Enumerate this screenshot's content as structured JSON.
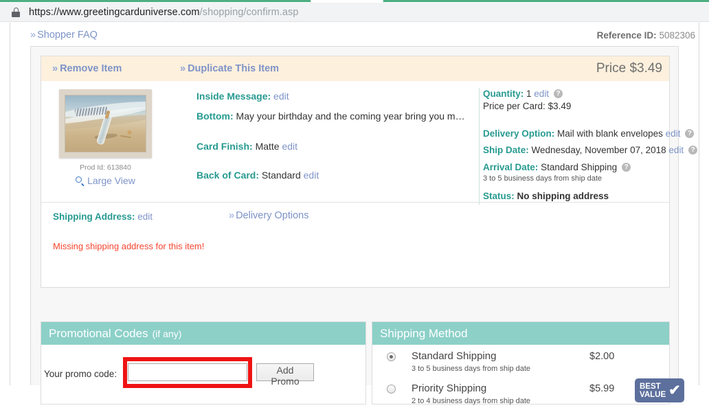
{
  "browser": {
    "url_secure_prefix": "https://www.greetingcarduniverse.com",
    "url_path": "/shopping/confirm.asp",
    "lock_icon": "lock-icon"
  },
  "page": {
    "shopper_faq": "Shopper FAQ",
    "guillemet": "»",
    "reference_label": "Reference ID:",
    "reference_value": "5082306"
  },
  "item": {
    "remove_label": "Remove Item",
    "duplicate_label": "Duplicate This Item",
    "price_label": "Price $3.49",
    "thumbnail": {
      "prod_id": "Prod Id: 613840",
      "large_view": "Large View",
      "magnifier_icon": "magnifier-icon"
    },
    "details": {
      "inside_message_label": "Inside Message:",
      "inside_message_edit": "edit",
      "bottom_label": "Bottom:",
      "bottom_value": "May your birthday and the coming year bring you m…",
      "card_finish_label": "Card Finish:",
      "card_finish_value": "Matte",
      "card_finish_edit": "edit",
      "back_of_card_label": "Back of Card:",
      "back_of_card_value": "Standard",
      "back_of_card_edit": "edit"
    },
    "order": {
      "quantity_label": "Quantity:",
      "quantity_value": "1",
      "quantity_edit": "edit",
      "price_per_card_label": "Price per Card:",
      "price_per_card_value": "$3.49",
      "delivery_option_label": "Delivery Option:",
      "delivery_option_value": "Mail with blank envelopes",
      "delivery_option_edit": "edit",
      "ship_date_label": "Ship Date:",
      "ship_date_value": "Wednesday, November 07, 2018",
      "ship_date_edit": "edit",
      "arrival_date_label": "Arrival Date:",
      "arrival_date_value": "Standard Shipping",
      "arrival_date_sub": "3 to 5 business days from ship date",
      "status_label": "Status:",
      "status_value": "No shipping address",
      "help_icon": "?"
    },
    "shipping_address": {
      "label": "Shipping Address:",
      "edit": "edit",
      "delivery_options_link": "Delivery Options",
      "error": "Missing shipping address for this item!"
    }
  },
  "promo_panel": {
    "title": "Promotional Codes",
    "subtitle": "(if any)",
    "field_label": "Your promo code:",
    "input_value": "",
    "input_placeholder": "",
    "add_button": "Add Promo"
  },
  "shipping_panel": {
    "title": "Shipping Method",
    "options": [
      {
        "name": "Standard Shipping",
        "sub": "3 to 5 business days from ship date",
        "price": "$2.00",
        "selected": true,
        "badge": null
      },
      {
        "name": "Priority Shipping",
        "sub": "2 to 4 business days from ship date",
        "price": "$5.99",
        "selected": false,
        "badge": {
          "line1": "BEST",
          "line2": "VALUE",
          "check": "✔"
        }
      }
    ]
  },
  "colors": {
    "teal_header": "#8cd0c8",
    "label_teal": "#279a90",
    "link_blue": "#7d93c7",
    "error_red": "#f5452f",
    "highlight_red": "#ef1313",
    "badge_blue": "#5d6f9c",
    "item_header_cream": "#fdf0dd",
    "browser_green": "#4caf82"
  }
}
